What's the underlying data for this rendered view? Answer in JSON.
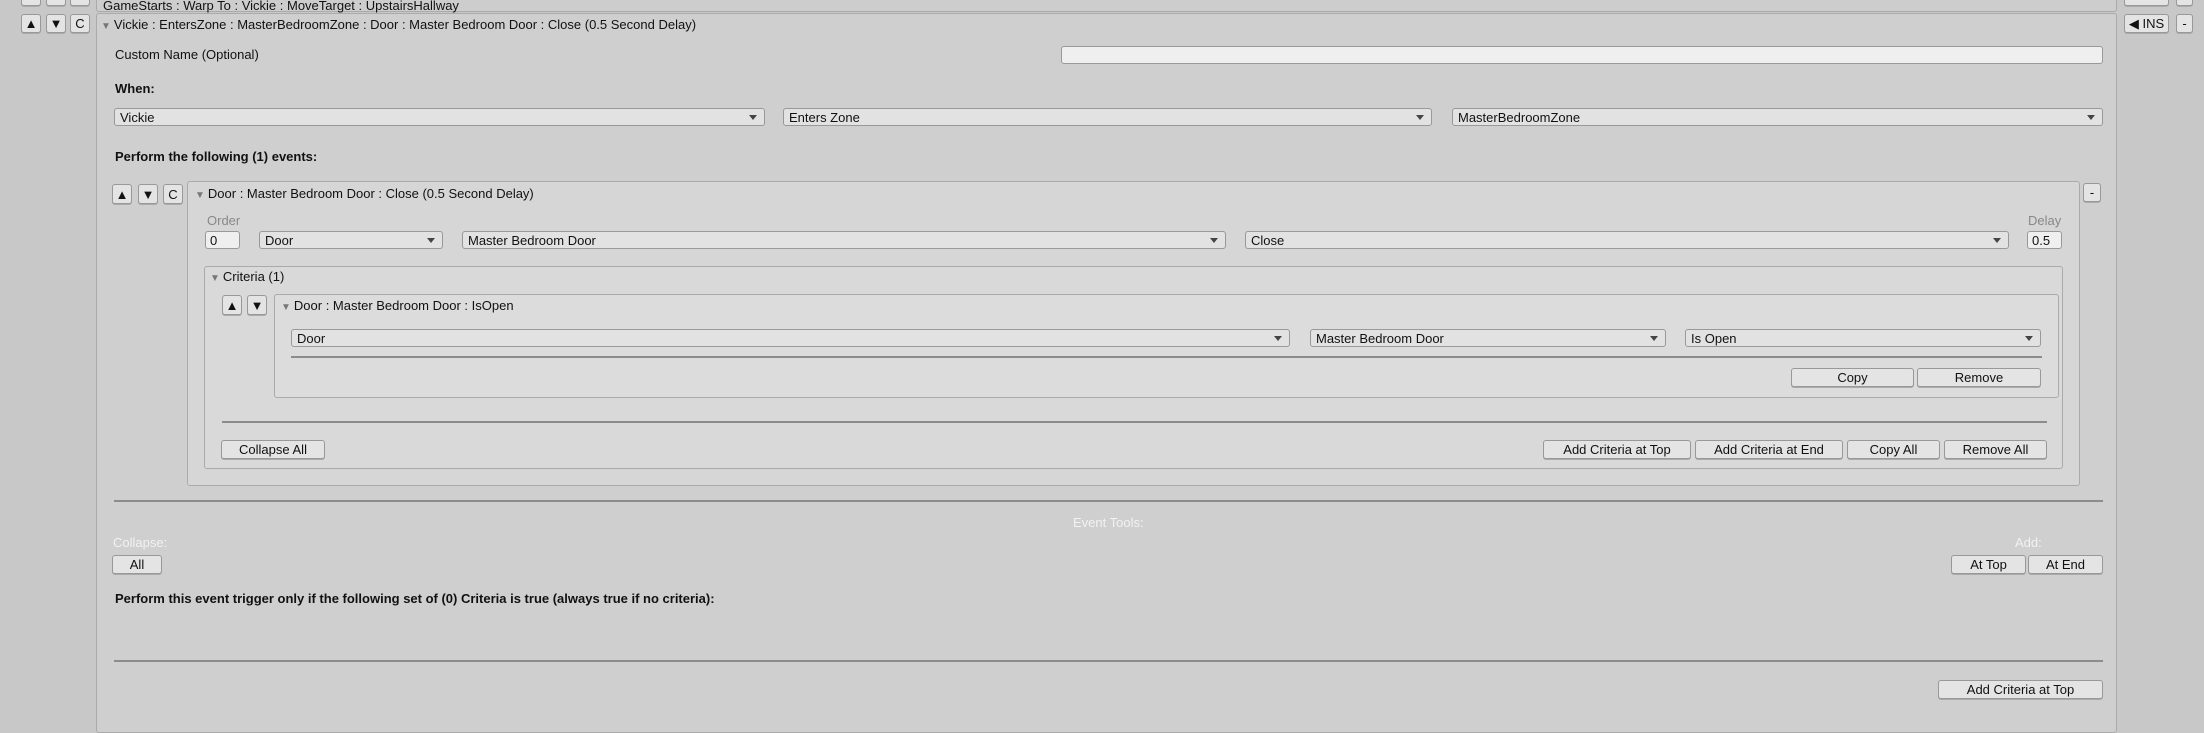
{
  "previous_trigger": {
    "title": "GameStarts : Warp To : Vickie : MoveTarget : UpstairsHallway"
  },
  "trigger": {
    "title": "Vickie : EntersZone : MasterBedroomZone : Door : Master Bedroom Door : Close (0.5 Second Delay)",
    "row_buttons": {
      "up": "▲",
      "down": "▼",
      "copy": "C"
    },
    "ins_label": "◀ INS",
    "remove_label": "-",
    "custom_name_label": "Custom Name (Optional)",
    "custom_name_value": "",
    "when_label": "When:",
    "when": {
      "actor": "Vickie",
      "condition": "Enters Zone",
      "zone": "MasterBedroomZone"
    },
    "events_heading": "Perform the following (1) events:",
    "event": {
      "title": "Door : Master Bedroom Door : Close (0.5 Second Delay)",
      "remove_label": "-",
      "order_label": "Order",
      "order_value": "0",
      "type": "Door",
      "target": "Master Bedroom Door",
      "action": "Close",
      "delay_label": "Delay",
      "delay_value": "0.5",
      "criteria": {
        "title": "Criteria (1)",
        "items": [
          {
            "title": "Door : Master Bedroom Door : IsOpen",
            "type": "Door",
            "target": "Master Bedroom Door",
            "condition": "Is Open",
            "copy_label": "Copy",
            "remove_label": "Remove"
          }
        ],
        "collapse_all": "Collapse All",
        "add_top": "Add Criteria at Top",
        "add_end": "Add Criteria at End",
        "copy_all": "Copy All",
        "remove_all": "Remove All"
      }
    },
    "event_tools": {
      "title": "Event Tools:",
      "collapse_label": "Collapse:",
      "all": "All",
      "add_label": "Add:",
      "at_top": "At Top",
      "at_end": "At End"
    },
    "trigger_criteria_heading": "Perform this event trigger only if the following set of (0) Criteria is true (always true if no criteria):",
    "add_criteria_top": "Add Criteria at Top"
  }
}
